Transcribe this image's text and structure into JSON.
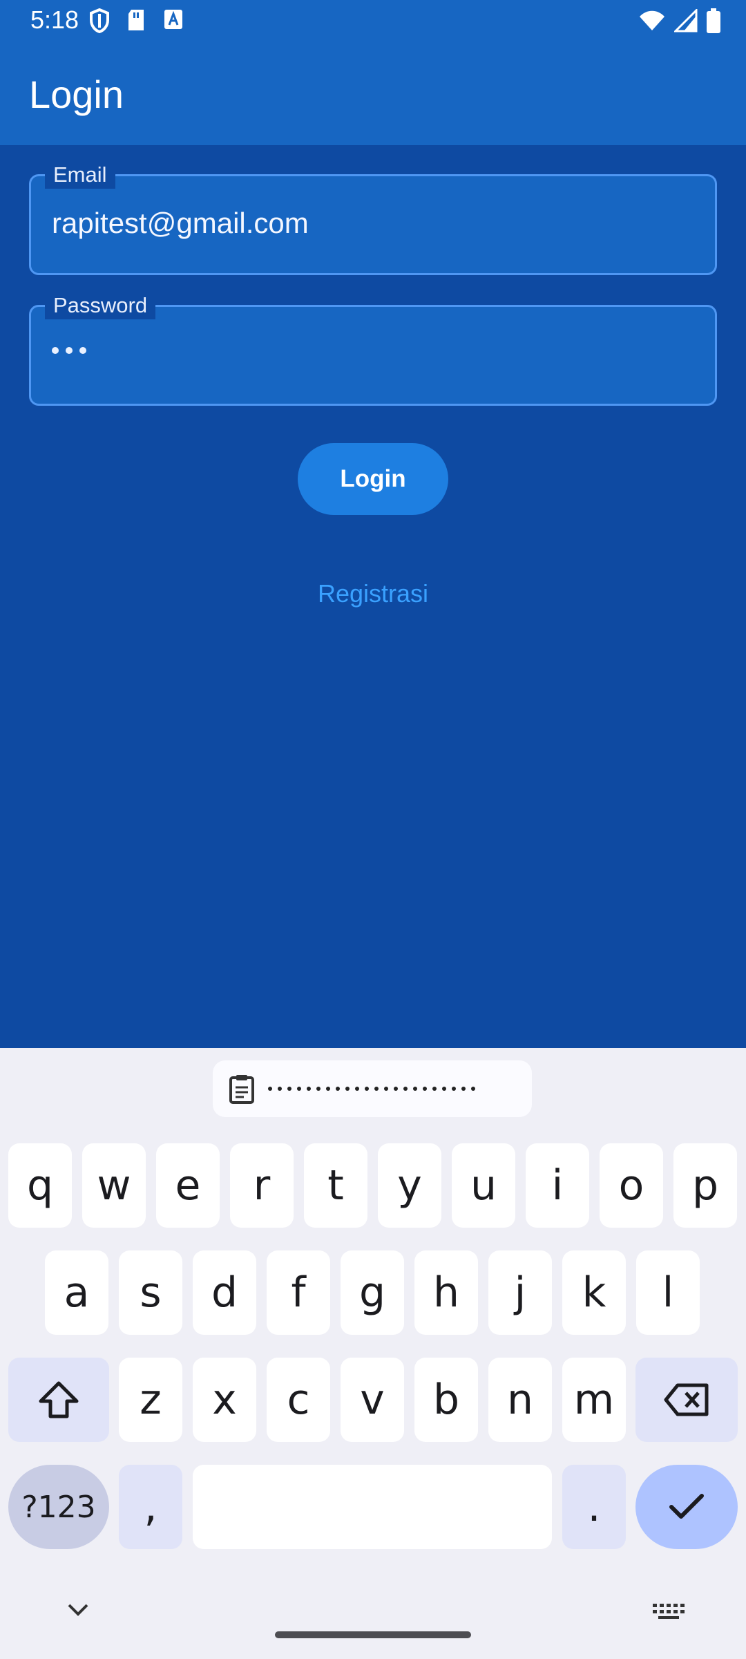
{
  "status": {
    "time": "5:18"
  },
  "appbar": {
    "title": "Login"
  },
  "form": {
    "email": {
      "label": "Email",
      "value": "rapitest@gmail.com"
    },
    "password": {
      "label": "Password",
      "masked_length": 3
    }
  },
  "buttons": {
    "login": "Login",
    "register": "Registrasi"
  },
  "keyboard": {
    "rows": [
      [
        "q",
        "w",
        "e",
        "r",
        "t",
        "y",
        "u",
        "i",
        "o",
        "p"
      ],
      [
        "a",
        "s",
        "d",
        "f",
        "g",
        "h",
        "j",
        "k",
        "l"
      ],
      [
        "z",
        "x",
        "c",
        "v",
        "b",
        "n",
        "m"
      ]
    ],
    "symbols_label": "?123",
    "comma": ",",
    "period": ".",
    "clipboard_masked": "••••••••••••••••••••••"
  },
  "colors": {
    "app_bar": "#1766c2",
    "background": "#0e4aa2",
    "accent": "#1e7fe1",
    "link": "#3aa1ff",
    "keyboard_bg": "#efeff6"
  }
}
